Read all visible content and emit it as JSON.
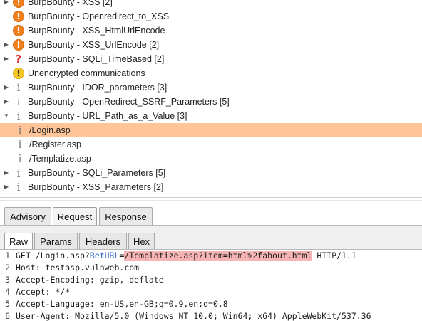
{
  "issues": [
    {
      "label": "BurpBounty - XSS [2]",
      "severity": "high",
      "expander": "collapsed",
      "indent": 0
    },
    {
      "label": "BurpBounty - Openredirect_to_XSS",
      "severity": "high",
      "expander": "none",
      "indent": 0
    },
    {
      "label": "BurpBounty - XSS_HtmlUrlEncode",
      "severity": "high",
      "expander": "none",
      "indent": 0
    },
    {
      "label": "BurpBounty - XSS_UrlEncode [2]",
      "severity": "high",
      "expander": "collapsed",
      "indent": 0
    },
    {
      "label": "BurpBounty - SQLi_TimeBased [2]",
      "severity": "tentative",
      "expander": "collapsed",
      "indent": 0
    },
    {
      "label": "Unencrypted communications",
      "severity": "info-yellow",
      "expander": "none",
      "indent": 0
    },
    {
      "label": "BurpBounty - IDOR_parameters [3]",
      "severity": "info",
      "expander": "collapsed",
      "indent": 0
    },
    {
      "label": "BurpBounty - OpenRedirect_SSRF_Parameters [5]",
      "severity": "info",
      "expander": "collapsed",
      "indent": 0
    },
    {
      "label": "BurpBounty - URL_Path_as_a_Value [3]",
      "severity": "info",
      "expander": "expanded",
      "indent": 0
    },
    {
      "label": "/Login.asp",
      "severity": "info",
      "expander": "none",
      "indent": 1,
      "selected": true
    },
    {
      "label": "/Register.asp",
      "severity": "info",
      "expander": "none",
      "indent": 1
    },
    {
      "label": "/Templatize.asp",
      "severity": "info",
      "expander": "none",
      "indent": 1
    },
    {
      "label": "BurpBounty - SQLi_Parameters [5]",
      "severity": "info",
      "expander": "collapsed",
      "indent": 0
    },
    {
      "label": "BurpBounty - XSS_Parameters [2]",
      "severity": "info",
      "expander": "collapsed",
      "indent": 0
    }
  ],
  "detail_tabs": [
    {
      "label": "Advisory",
      "active": false
    },
    {
      "label": "Request",
      "active": true
    },
    {
      "label": "Response",
      "active": false
    }
  ],
  "view_tabs": [
    {
      "label": "Raw",
      "active": true
    },
    {
      "label": "Params",
      "active": false
    },
    {
      "label": "Headers",
      "active": false
    },
    {
      "label": "Hex",
      "active": false
    }
  ],
  "request": {
    "line1": {
      "num": "1",
      "before": "GET /Login.asp?",
      "param": "RetURL",
      "eq": "=",
      "highlight": "/Templatize.asp?item=html%2fabout.html",
      "after": " HTTP/1.1"
    },
    "lines": [
      {
        "num": "2",
        "text": "Host: testasp.vulnweb.com"
      },
      {
        "num": "3",
        "text": "Accept-Encoding: gzip, deflate"
      },
      {
        "num": "4",
        "text": "Accept: */*"
      },
      {
        "num": "5",
        "text": "Accept-Language: en-US,en-GB;q=0.9,en;q=0.8"
      },
      {
        "num": "6",
        "text": "User-Agent: Mozilla/5.0 (Windows NT 10.0; Win64; x64) AppleWebKit/537.36"
      }
    ]
  },
  "icons": {
    "high": "exclamation-circle-orange",
    "info-yellow": "exclamation-circle-yellow",
    "tentative": "question-mark-red",
    "info": "info-letter-grey"
  },
  "colors": {
    "selected_row": "#ffc598",
    "highlight": "#f7b4b4",
    "param_name": "#1a54c8",
    "high_severity": "#f07f1e"
  }
}
